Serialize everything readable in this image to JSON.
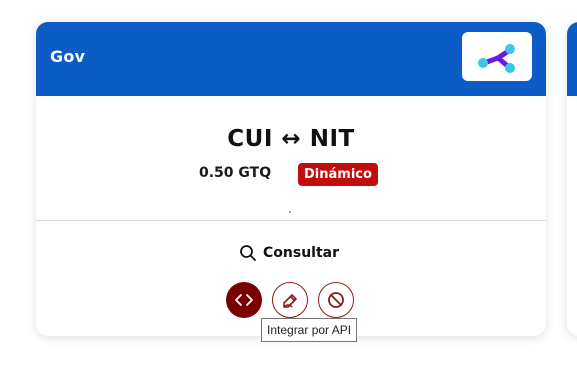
{
  "card": {
    "category": "Gov",
    "title": "CUI ↔ NIT",
    "price": "0.50 GTQ",
    "badge": "Dinámico",
    "consult_label": "Consultar",
    "logo_icon": "share-network-icon"
  },
  "actions": [
    {
      "name": "api-button",
      "icon": "code-brackets-icon"
    },
    {
      "name": "edit-button",
      "icon": "pencil-icon"
    },
    {
      "name": "disable-button",
      "icon": "block-icon"
    }
  ],
  "tooltip": "Integrar por API",
  "colors": {
    "header_blue": "#0b5cc4",
    "badge_red": "#c20d0d",
    "action_dark_red": "#7a0000",
    "logo_cyan": "#3cc8e6",
    "logo_purple": "#6a1bd6"
  }
}
